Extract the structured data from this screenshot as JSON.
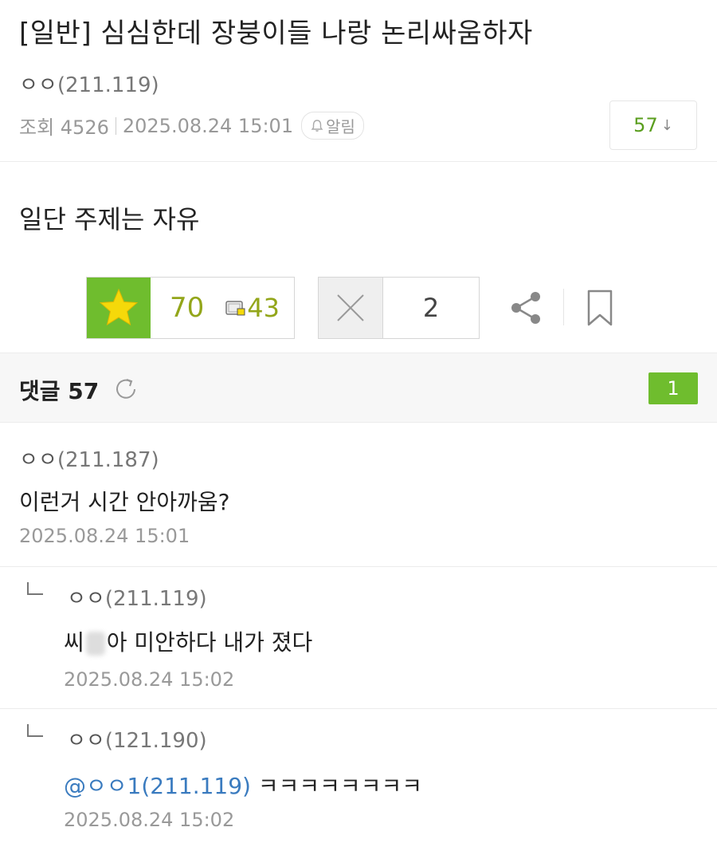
{
  "post": {
    "title": "[일반] 심심한데 장붕이들 나랑 논리싸움하자",
    "author_name": "ㅇㅇ",
    "author_ip": "(211.119)",
    "views": "조회 4526",
    "date": "2025.08.24 15:01",
    "alarm_label": "알림",
    "comment_count": "57",
    "body": "일단 주제는 자유"
  },
  "actions": {
    "recommend": "70",
    "fix_recommend": "43",
    "nonrecommend": "2"
  },
  "comments_header": {
    "label": "댓글 57",
    "page": "1"
  },
  "comments": [
    {
      "author": "ㅇㅇ",
      "ip": "(211.187)",
      "text": "이런거 시간 안아까움?",
      "date": "2025.08.24 15:01"
    },
    {
      "author": "ㅇㅇ",
      "ip": "(211.119)",
      "text_a": "씨",
      "text_b": "아 미안하다 내가 졌다",
      "date": "2025.08.24 15:02"
    },
    {
      "author": "ㅇㅇ",
      "ip": "(121.190)",
      "mention": "@ㅇㅇ1(211.119)",
      "text": "ㅋㅋㅋㅋㅋㅋㅋㅋ",
      "date": "2025.08.24 15:02"
    }
  ],
  "icons": [
    "star-icon",
    "fix-recommend-icon",
    "x-icon",
    "share-icon",
    "bookmark-icon",
    "refresh-icon",
    "bell-icon",
    "reply-arrow-icon"
  ],
  "colors": {
    "accent_green": "#6fbd2e",
    "count_green": "#5a9e1e",
    "mention_blue": "#3a7bbf",
    "star_yellow": "#f5d90a"
  }
}
